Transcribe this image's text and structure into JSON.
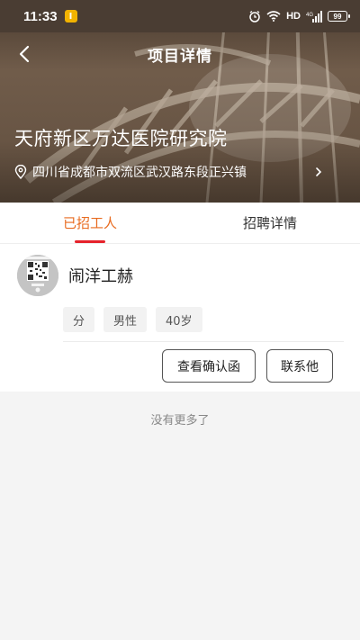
{
  "status_bar": {
    "time": "11:33",
    "app_badge": "I",
    "network": "HD",
    "signal_label": "4G",
    "battery": "99"
  },
  "nav": {
    "title": "项目详情",
    "back_icon": "chevron-left-icon"
  },
  "project": {
    "name": "天府新区万达医院研究院",
    "address": "四川省成都市双流区武汉路东段正兴镇",
    "address_icon": "location-pin-icon"
  },
  "tabs": [
    {
      "label": "已招工人",
      "active": true
    },
    {
      "label": "招聘详情",
      "active": false
    }
  ],
  "worker": {
    "name": "闹洋工赫",
    "tags": [
      "分",
      "男性",
      "40岁"
    ],
    "actions": {
      "view_letter": "查看确认函",
      "contact": "联系他"
    }
  },
  "footer": {
    "no_more": "没有更多了"
  },
  "colors": {
    "accent_orange": "#e86a1e",
    "underline_red": "#e5222b",
    "page_bg": "#f4f4f4"
  }
}
